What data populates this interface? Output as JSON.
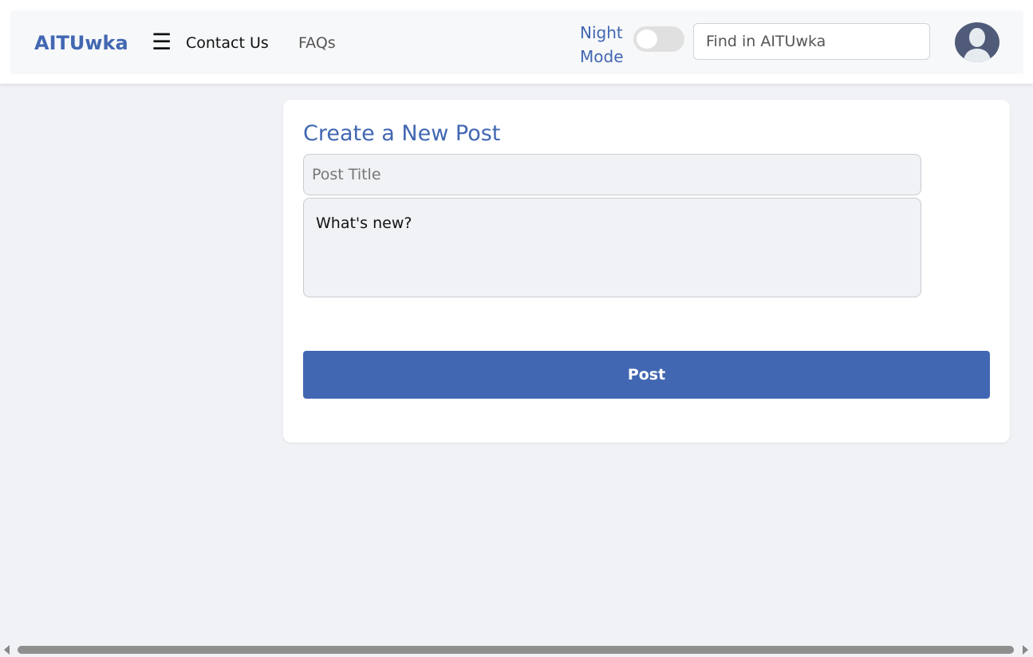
{
  "navbar": {
    "brand": "AITUwka",
    "menu_icon": "hamburger-icon",
    "links": [
      {
        "label": "Contact Us"
      },
      {
        "label": "FAQs"
      }
    ],
    "night_mode_label_line1": "Night",
    "night_mode_label_line2": "Mode",
    "night_mode_enabled": false,
    "search_placeholder": "Find in AITUwka",
    "avatar_icon": "user-avatar-icon"
  },
  "post_form": {
    "heading": "Create a New Post",
    "title_placeholder": "Post Title",
    "body_placeholder": "What's new?",
    "submit_label": "Post"
  },
  "colors": {
    "brand": "#4267b2",
    "page_bg": "#f0f2f5",
    "navbar_bg": "#f7f8fa",
    "button_bg": "#4267b2"
  }
}
